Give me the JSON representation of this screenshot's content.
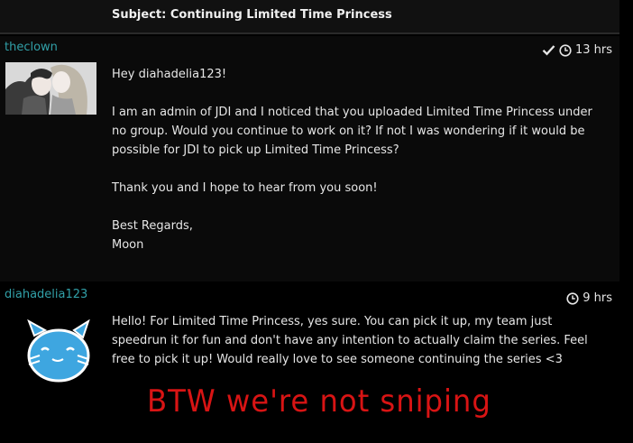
{
  "thread": {
    "subject": "Subject: Continuing Limited Time Princess"
  },
  "posts": [
    {
      "username": "theclown",
      "time": "13 hrs",
      "read_icon": "checkmark-icon",
      "time_icon": "clock-icon",
      "paragraphs": [
        "Hey diahadelia123!",
        "I am an admin of JDI and I noticed that you uploaded Limited Time Princess under no group. Would you continue to work on it? If not I was wondering if it would be possible for JDI to pick up Limited Time Princess?",
        "Thank you and I hope to hear from you soon!",
        "Best Regards,\nMoon"
      ]
    },
    {
      "username": "diahadelia123",
      "time": "9 hrs",
      "time_icon": "clock-icon",
      "paragraphs": [
        "Hello! For Limited Time Princess, yes sure. You can pick it up, my team just speedrun it for fun and don't have any intention to actually claim the series. Feel free to pick it up! Would really love to see someone continuing the series <3"
      ]
    }
  ],
  "annotation": {
    "text": "BTW we're not sniping",
    "color": "#d81414"
  },
  "colors": {
    "username": "#31a0a8",
    "background": "#000000",
    "post_background": "#0a0a0a"
  }
}
